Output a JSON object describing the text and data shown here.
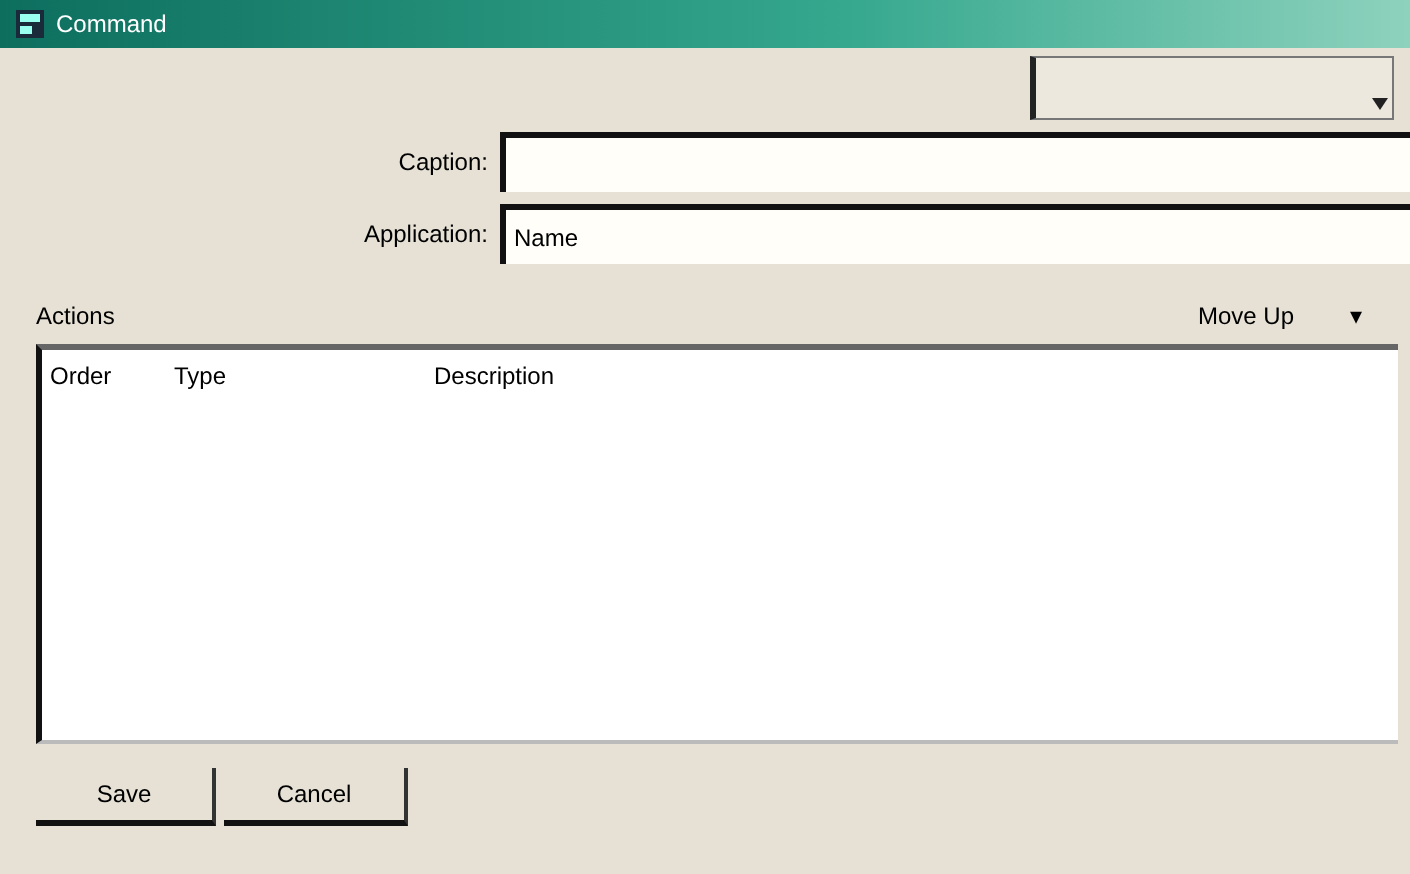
{
  "window": {
    "title": "Command"
  },
  "fields": [
    {
      "label": "Caption:"
    },
    {
      "label": "Application:",
      "value": "Name"
    }
  ],
  "actions": {
    "label": "Actions",
    "move_button": "Move Up",
    "arrow": "▾"
  },
  "table": {
    "columns": [
      "Order",
      "Type",
      "Description"
    ]
  },
  "buttons": [
    "Save",
    "Cancel"
  ]
}
